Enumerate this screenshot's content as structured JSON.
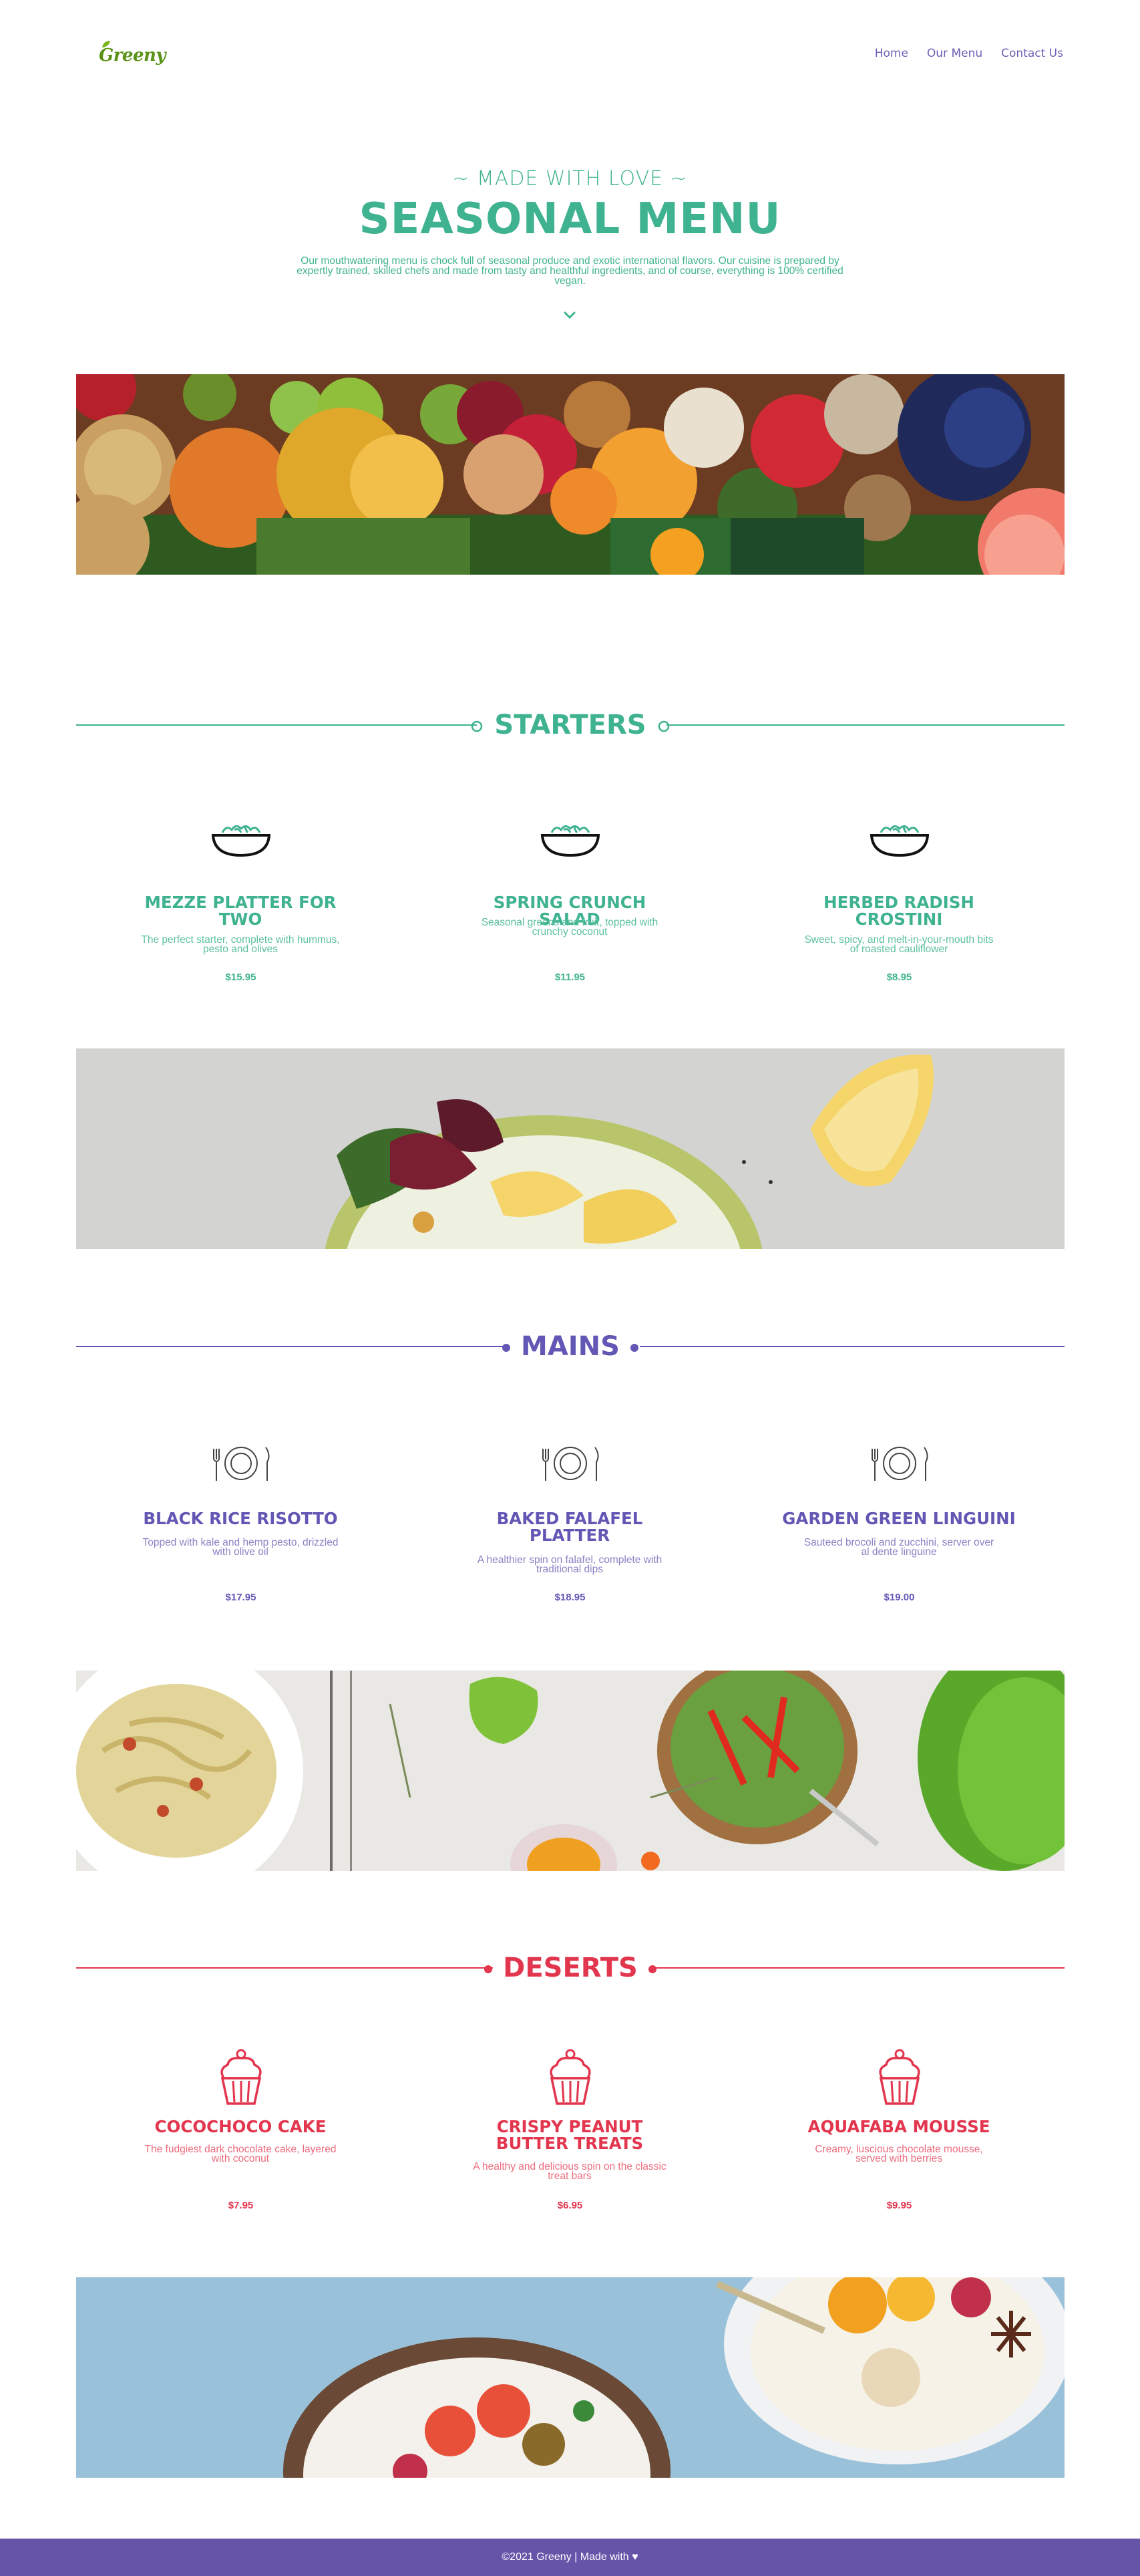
{
  "brand": {
    "logo_text": "Greeny"
  },
  "nav": {
    "links": [
      "Home",
      "Our Menu",
      "Contact Us"
    ]
  },
  "hero": {
    "kicker": "~ MADE WITH LOVE ~",
    "title": "SEASONAL MENU",
    "description": "Our mouthwatering menu is chock full of seasonal produce and exotic international flavors. Our cuisine is prepared by expertly trained, skilled chefs and made from tasty and healthful ingredients, and of course, everything is 100% certified vegan."
  },
  "sections": [
    {
      "title": "STARTERS",
      "color": "#3fb28f",
      "icon": "salad-bowl-icon",
      "items": [
        {
          "name": "MEZZE PLATTER FOR TWO",
          "description": "The perfect starter, complete with hummus, pesto and olives",
          "price": "$15.95"
        },
        {
          "name": "SPRING CRUNCH SALAD",
          "description": "Seasonal greens and fruit, topped with crunchy coconut",
          "price": "$11.95"
        },
        {
          "name": "HERBED RADISH CROSTINI",
          "description": "Sweet, spicy, and melt-in-your-mouth bits of roasted cauliflower",
          "price": "$8.95"
        }
      ]
    },
    {
      "title": "MAINS",
      "color": "#6257b4",
      "icon": "plate-cutlery-icon",
      "items": [
        {
          "name": "BLACK RICE RISOTTO",
          "description": "Topped with kale and hemp pesto, drizzled with olive oil",
          "price": "$17.95"
        },
        {
          "name": "BAKED FALAFEL PLATTER",
          "description": "A healthier spin on falafel, complete with traditional dips",
          "price": "$18.95"
        },
        {
          "name": "GARDEN GREEN LINGUINI",
          "description": "Sauteed brocoli and zucchini, server over al dente linguine",
          "price": "$19.00"
        }
      ]
    },
    {
      "title": "DESERTS",
      "color": "#e2364e",
      "icon": "cupcake-icon",
      "items": [
        {
          "name": "COCOCHOCO CAKE",
          "description": "The fudgiest dark chocolate cake, layered with coconut",
          "price": "$7.95"
        },
        {
          "name": "CRISPY PEANUT BUTTER TREATS",
          "description": "A healthy and delicious spin on the classic treat bars",
          "price": "$6.95"
        },
        {
          "name": "AQUAFABA MOUSSE",
          "description": "Creamy, luscious chocolate mousse, served with berries",
          "price": "$9.95"
        }
      ]
    }
  ],
  "footer": {
    "text": "©2021 Greeny | Made with ♥"
  }
}
